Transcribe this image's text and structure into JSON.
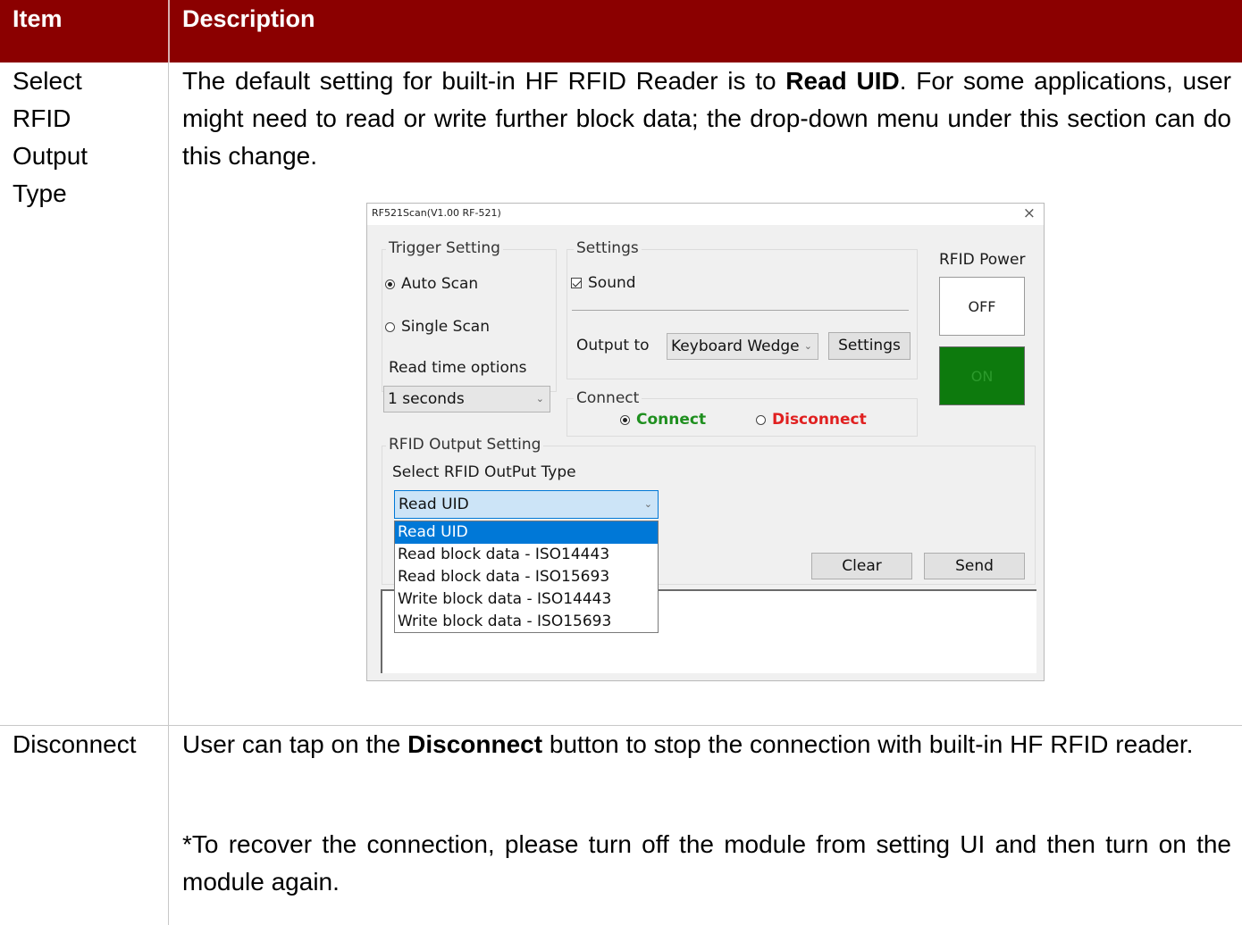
{
  "table": {
    "headers": {
      "item": "Item",
      "description": "Description"
    },
    "rows": [
      {
        "item": "Select RFID Output Type",
        "item_lines": [
          "Select",
          "RFID",
          "Output",
          "Type"
        ],
        "desc_pre": "The default setting for built-in HF RFID Reader is to ",
        "desc_bold": "Read UID",
        "desc_post": ". For some applications, user might need to read or write further block data; the drop-down menu under this section can do this change."
      },
      {
        "item": "Disconnect",
        "desc_pre": "User can tap on the ",
        "desc_bold": "Disconnect",
        "desc_post": " button to stop the connection with built-in HF RFID reader.",
        "note": "*To recover the connection, please turn off the module from setting UI and then turn on the module again."
      }
    ]
  },
  "app": {
    "title": "RF521Scan(V1.00 RF-521)",
    "close_icon": "×",
    "trigger": {
      "label": "Trigger Setting",
      "auto_scan": "Auto Scan",
      "single_scan": "Single Scan",
      "auto_selected": true
    },
    "read_time": {
      "label": "Read time options",
      "value": "1 seconds"
    },
    "settings": {
      "label": "Settings",
      "sound": "Sound",
      "sound_checked": true,
      "output_label": "Output to",
      "output_value": "Keyboard Wedge",
      "settings_button": "Settings"
    },
    "rfid_power": {
      "label": "RFID Power",
      "off": "OFF",
      "on": "ON"
    },
    "connect": {
      "label": "Connect",
      "connect": "Connect",
      "disconnect": "Disconnect",
      "connected": true,
      "connect_color": "#1f8f1f",
      "disconnect_color": "#e02020"
    },
    "output_setting": {
      "label": "RFID Output Setting",
      "type_label": "Select RFID OutPut Type",
      "selected": "Read UID",
      "options": [
        "Read UID",
        "Read block data - ISO14443",
        "Read block data - ISO15693",
        "Write block data - ISO14443",
        "Write block data - ISO15693"
      ]
    },
    "buttons": {
      "clear": "Clear",
      "send": "Send"
    }
  },
  "colors": {
    "header_bg": "#8b0000",
    "header_text": "#ffffff",
    "selection": "#0078d7",
    "power_on": "#0d7a0d"
  }
}
